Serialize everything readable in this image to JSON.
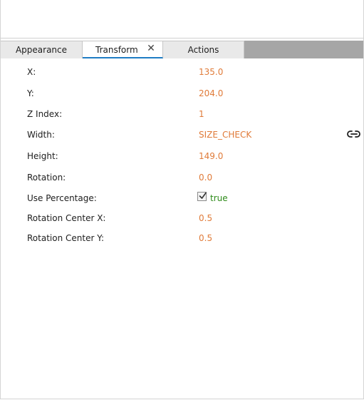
{
  "tabs": [
    {
      "label": "Appearance"
    },
    {
      "label": "Transform"
    },
    {
      "label": "Actions"
    }
  ],
  "tab_close_glyph": "✕",
  "active_tab": "Transform",
  "properties": {
    "x": {
      "label": "X:",
      "value": "135.0"
    },
    "y": {
      "label": "Y:",
      "value": "204.0"
    },
    "z_index": {
      "label": "Z Index:",
      "value": "1"
    },
    "width": {
      "label": "Width:",
      "value": "SIZE_CHECK",
      "icon": "link-icon"
    },
    "height": {
      "label": "Height:",
      "value": "149.0"
    },
    "rotation": {
      "label": "Rotation:",
      "value": "0.0"
    },
    "use_percentage": {
      "label": "Use Percentage:",
      "value": "true",
      "checked": true
    },
    "rotation_center_x": {
      "label": "Rotation Center X:",
      "value": "0.5"
    },
    "rotation_center_y": {
      "label": "Rotation Center Y:",
      "value": "0.5"
    }
  },
  "colors": {
    "value_text": "#e07b39",
    "bool_text": "#2e8b1a",
    "active_tab_underline": "#1f7cc4",
    "tab_strip_bg": "#a6a6a6"
  }
}
